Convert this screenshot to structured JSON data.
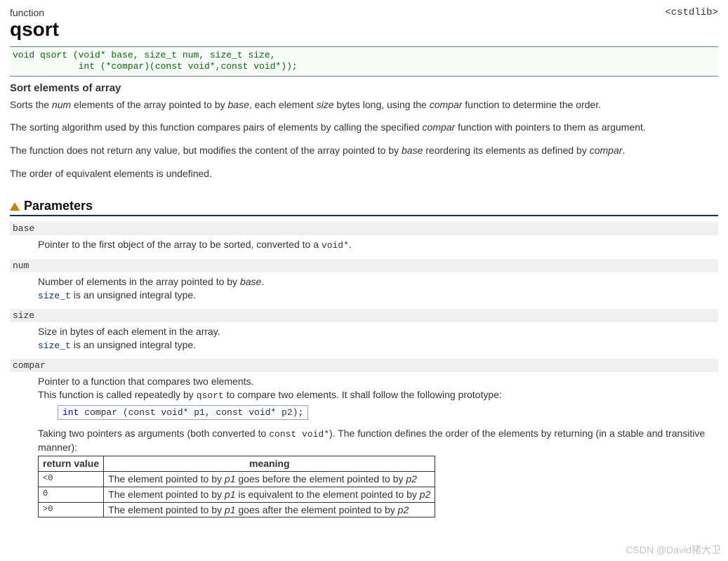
{
  "header": {
    "kind": "function",
    "name": "qsort",
    "libheader": "<cstdlib>"
  },
  "signature": "void qsort (void* base, size_t num, size_t size,\n            int (*compar)(const void*,const void*));",
  "subtitle": "Sort elements of array",
  "desc": {
    "p1_a": "Sorts the ",
    "p1_num": "num",
    "p1_b": " elements of the array pointed to by ",
    "p1_base": "base",
    "p1_c": ", each element ",
    "p1_size": "size",
    "p1_d": " bytes long, using the ",
    "p1_compar": "compar",
    "p1_e": " function to determine the order.",
    "p2_a": "The sorting algorithm used by this function compares pairs of elements by calling the specified ",
    "p2_compar": "compar",
    "p2_b": " function with pointers to them as argument.",
    "p3_a": "The function does not return any value, but modifies the content of the array pointed to by ",
    "p3_base": "base",
    "p3_b": " reordering its elements as defined by ",
    "p3_compar": "compar",
    "p3_c": ".",
    "p4": "The order of equivalent elements is undefined."
  },
  "sections": {
    "parameters": "Parameters"
  },
  "params": {
    "base": {
      "name": "base",
      "d1_a": "Pointer to the first object of the array to be sorted, converted to a ",
      "d1_code": "void*",
      "d1_b": "."
    },
    "num": {
      "name": "num",
      "d1_a": "Number of elements in the array pointed to by ",
      "d1_base": "base",
      "d1_b": ".",
      "d2_code": "size_t",
      "d2_b": " is an unsigned integral type."
    },
    "size": {
      "name": "size",
      "d1": "Size in bytes of each element in the array.",
      "d2_code": "size_t",
      "d2_b": " is an unsigned integral type."
    },
    "compar": {
      "name": "compar",
      "d1": "Pointer to a function that compares two elements.",
      "d2_a": "This function is called repeatedly by ",
      "d2_code": "qsort",
      "d2_b": " to compare two elements. It shall follow the following prototype:",
      "proto_kw": "int",
      "proto_rest": " compar (const void* p1, const void* p2);",
      "d3_a": "Taking two pointers as arguments (both converted to ",
      "d3_code": "const void*",
      "d3_b": "). The function defines the order of the elements by returning (in a stable and transitive manner):"
    }
  },
  "rettable": {
    "h1": "return value",
    "h2": "meaning",
    "r1_v": "<0",
    "r1_a": "The element pointed to by ",
    "r1_p1": "p1",
    "r1_b": " goes before the element pointed to by ",
    "r1_p2": "p2",
    "r2_v": "0",
    "r2_a": "The element pointed to by ",
    "r2_p1": "p1",
    "r2_b": " is equivalent to the element pointed to by ",
    "r2_p2": "p2",
    "r3_v": ">0",
    "r3_a": "The element pointed to by ",
    "r3_p1": "p1",
    "r3_b": " goes after the element pointed to by ",
    "r3_p2": "p2"
  },
  "watermark": "CSDN @David猪大卫"
}
